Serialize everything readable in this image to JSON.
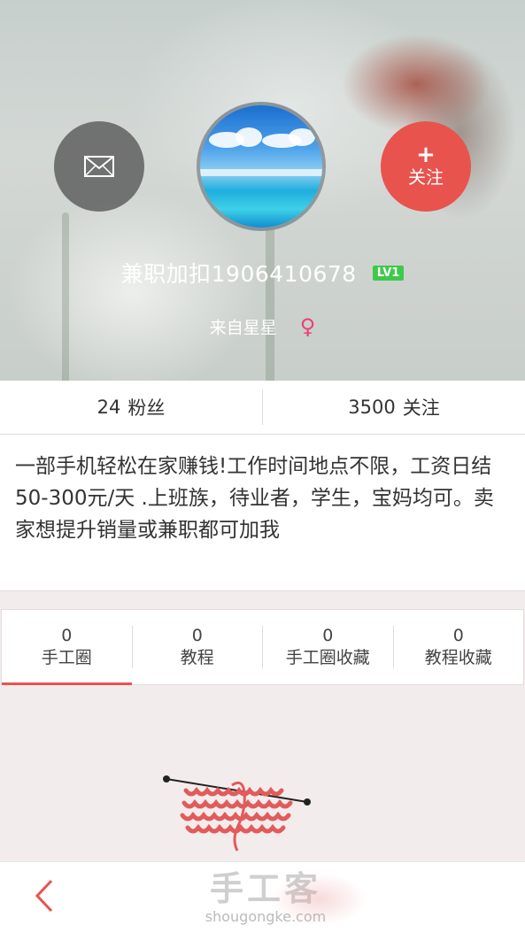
{
  "header": {
    "username": "兼职加扣1906410678",
    "level_badge": "LV1",
    "location": "来自星星",
    "gender_icon": "female-icon",
    "follow_plus": "+",
    "follow_label": "关注",
    "message_icon": "envelope-icon"
  },
  "stats": {
    "fans_count": "24",
    "fans_label": "粉丝",
    "following_count": "3500",
    "following_label": "关注"
  },
  "bio": "一部手机轻松在家赚钱!工作时间地点不限，工资日结50-300元/天 .上班族，待业者，学生，宝妈均可。卖家想提升销量或兼职都可加我",
  "tabs": [
    {
      "count": "0",
      "label": "手工圈",
      "active": true
    },
    {
      "count": "0",
      "label": "教程",
      "active": false
    },
    {
      "count": "0",
      "label": "手工圈收藏",
      "active": false
    },
    {
      "count": "0",
      "label": "教程收藏",
      "active": false
    }
  ],
  "empty_state_icon": "knitting-illustration-icon",
  "bottom_bar": {
    "back_icon": "back-chevron-icon",
    "watermark_title": "手工客",
    "watermark_url": "shougongke.com"
  },
  "colors": {
    "accent": "#e8534e",
    "level_green": "#3ec94a",
    "female_pink": "#e8417a"
  }
}
